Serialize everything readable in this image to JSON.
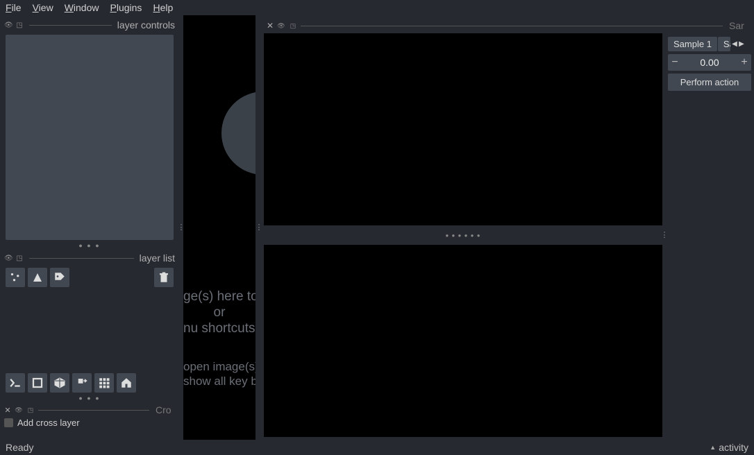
{
  "menu": {
    "file": "File",
    "view": "View",
    "window": "Window",
    "plugins": "Plugins",
    "help": "Help"
  },
  "left": {
    "layer_controls_label": "layer controls",
    "layer_list_label": "layer list",
    "cross_section_visible": "Cro",
    "cross_checkbox_label": "Add cross layer"
  },
  "canvas": {
    "drop_l1": "ge(s) here to open",
    "drop_l2": "or",
    "drop_l3": "nu shortcuts below",
    "cmd_l1": "open image(s)",
    "cmd_l2": "show all key bindings"
  },
  "dock": {
    "title_visible": "Sar"
  },
  "side": {
    "tab1": "Sample 1",
    "tab2_visible": "Sa",
    "spin_value": "0.00",
    "action_label": "Perform action"
  },
  "status": {
    "left": "Ready",
    "right": "activity"
  }
}
